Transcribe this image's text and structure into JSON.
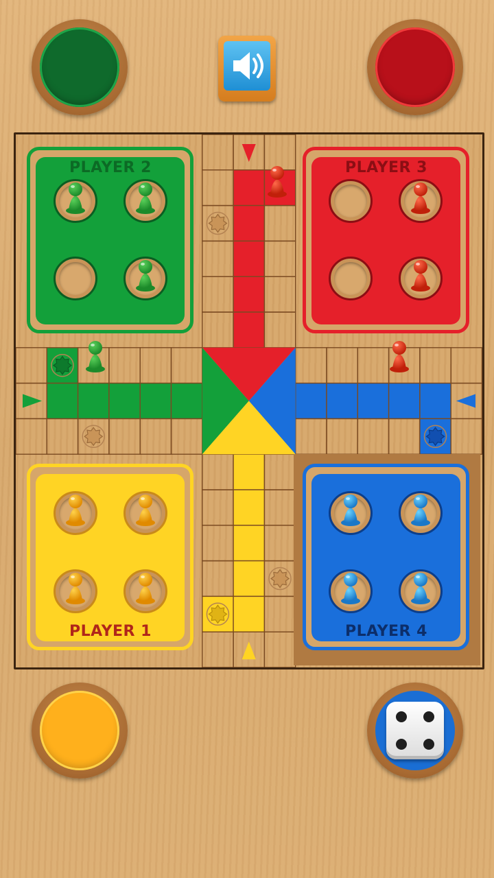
{
  "colors": {
    "green": "#13a03a",
    "red": "#e5202a",
    "blue": "#1a6fdb",
    "yellow": "#ffd424",
    "wood": "#d6a66a"
  },
  "top_bar": {
    "sound_icon": "speaker-volume-icon"
  },
  "bases": {
    "green": {
      "label": "PLAYER 2",
      "pawns_in_base": 3
    },
    "red": {
      "label": "PLAYER 3",
      "pawns_in_base": 2
    },
    "yellow": {
      "label": "PLAYER 1",
      "pawns_in_base": 4
    },
    "blue": {
      "label": "PLAYER 4",
      "pawns_in_base": 4
    }
  },
  "dice": {
    "value": 4,
    "icon": "dice-four-icon"
  }
}
